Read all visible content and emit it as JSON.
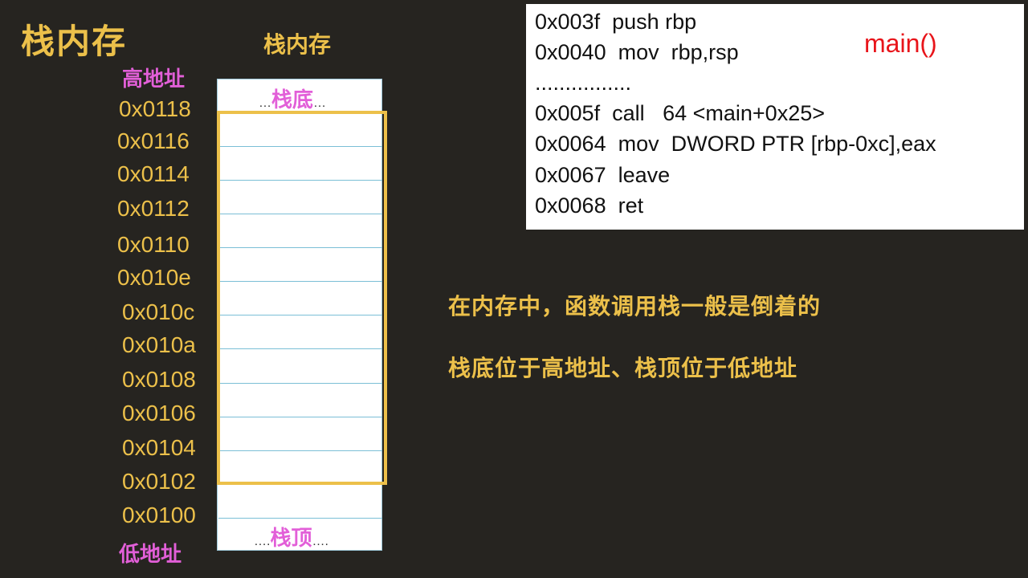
{
  "title": "栈内存",
  "stack": {
    "header": "栈内存",
    "high_label": "高地址",
    "low_label": "低地址",
    "addresses": [
      "0x0118",
      "0x0116",
      "0x0114",
      "0x0112",
      "0x0110",
      "0x010e",
      "0x010c",
      "0x010a",
      "0x0108",
      "0x0106",
      "0x0104",
      "0x0102",
      "0x0100"
    ],
    "bottom_cell": {
      "prefix": "…",
      "label": "栈底",
      "suffix": "…"
    },
    "top_cell": {
      "prefix": "….",
      "label": "栈顶",
      "suffix": "…."
    }
  },
  "code": {
    "function": "main()",
    "lines": [
      "0x003f  push rbp",
      "0x0040  mov  rbp,rsp",
      "................",
      "0x005f  call   64 <main+0x25>",
      "0x0064  mov  DWORD PTR [rbp-0xc],eax",
      "0x0067  leave",
      "0x0068  ret"
    ]
  },
  "notes": [
    "在内存中，函数调用栈一般是倒着的",
    "栈底位于高地址、栈顶位于低地址"
  ],
  "colors": {
    "background": "#262420",
    "accent": "#ecc04a",
    "label": "#e25fd8",
    "function": "#e8141a"
  }
}
